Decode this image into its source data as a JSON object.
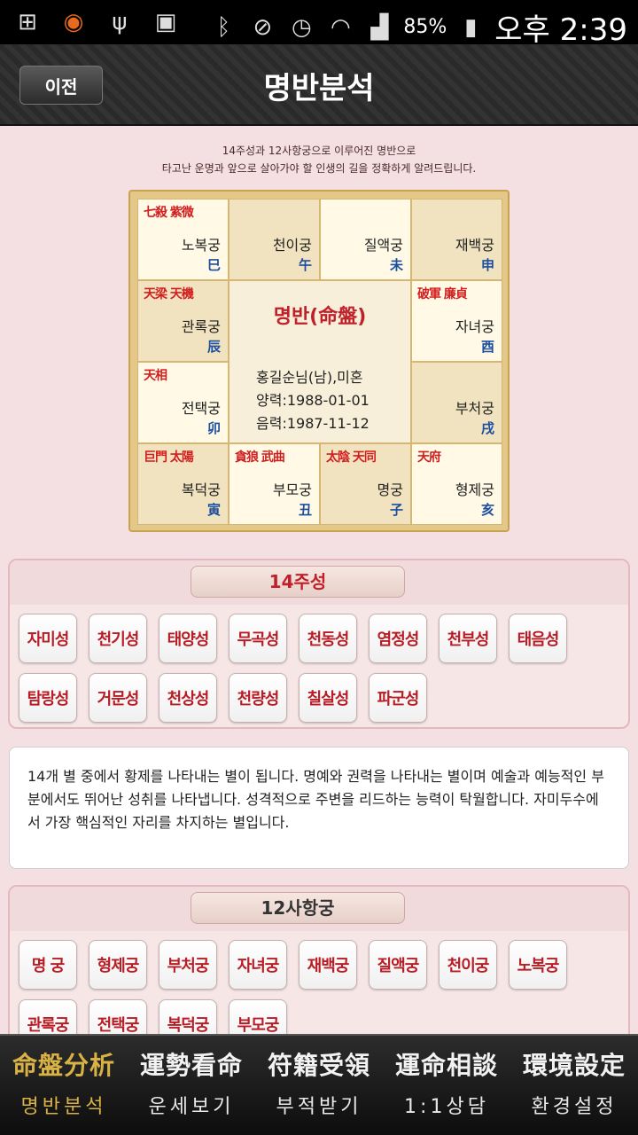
{
  "status_bar": {
    "icons": [
      "plus-icon",
      "headphones-icon",
      "usb-icon",
      "image-icon",
      "bluetooth-icon",
      "mute-icon",
      "alarm-icon",
      "wifi-icon",
      "signal-icon",
      "battery-icon"
    ],
    "battery": "85%",
    "time": "오후 2:39"
  },
  "header": {
    "back_label": "이전",
    "title": "명반분석"
  },
  "intro": {
    "line1": "14주성과 12사항궁으로 이루어진 명반으로",
    "line2": "타고난 운명과 앞으로 살아가야 할 인생의 길을 정확하게 알려드립니다."
  },
  "chart": {
    "cells": [
      {
        "stars": "七殺 紫微",
        "palace": "노복궁",
        "branch": "巳"
      },
      {
        "stars": "",
        "palace": "천이궁",
        "branch": "午"
      },
      {
        "stars": "",
        "palace": "질액궁",
        "branch": "未"
      },
      {
        "stars": "",
        "palace": "재백궁",
        "branch": "申"
      },
      {
        "stars": "天梁 天機",
        "palace": "관록궁",
        "branch": "辰"
      },
      {
        "stars": "破軍 廉貞",
        "palace": "자녀궁",
        "branch": "酉"
      },
      {
        "stars": "天相",
        "palace": "전택궁",
        "branch": "卯"
      },
      {
        "stars": "",
        "palace": "부처궁",
        "branch": "戌"
      },
      {
        "stars": "巨門 太陽",
        "palace": "복덕궁",
        "branch": "寅"
      },
      {
        "stars": "貪狼 武曲",
        "palace": "부모궁",
        "branch": "丑"
      },
      {
        "stars": "太陰 天同",
        "palace": "명궁",
        "branch": "子"
      },
      {
        "stars": "天府",
        "palace": "형제궁",
        "branch": "亥"
      }
    ],
    "center": {
      "title": "명반(命盤)",
      "name": "홍길순님(남),미혼",
      "solar": "양력:1988-01-01",
      "lunar": "음력:1987-11-12"
    }
  },
  "main_stars": {
    "title": "14주성",
    "items": [
      "자미성",
      "천기성",
      "태양성",
      "무곡성",
      "천동성",
      "염정성",
      "천부성",
      "태음성",
      "탐랑성",
      "거문성",
      "천상성",
      "천량성",
      "칠살성",
      "파군성"
    ]
  },
  "description": "14개 별 중에서 황제를 나타내는 별이 됩니다. 명예와 권력을 나타내는 별이며 예술과 예능적인 부분에서도 뛰어난 성취를 나타냅니다. 성격적으로 주변을 리드하는 능력이 탁월합니다. 자미두수에서 가장 핵심적인 자리를 차지하는 별입니다.",
  "palaces": {
    "title": "12사항궁",
    "items": [
      "명 궁",
      "형제궁",
      "부처궁",
      "자녀궁",
      "재백궁",
      "질액궁",
      "천이궁",
      "노복궁",
      "관록궁",
      "전택궁",
      "복덕궁",
      "부모궁"
    ]
  },
  "bottom_nav": [
    {
      "hanja": "命盤分析",
      "label": "명반분석",
      "active": true
    },
    {
      "hanja": "運勢看命",
      "label": "운세보기",
      "active": false
    },
    {
      "hanja": "符籍受領",
      "label": "부적받기",
      "active": false
    },
    {
      "hanja": "運命相談",
      "label": "1:1상담",
      "active": false
    },
    {
      "hanja": "環境設定",
      "label": "환경설정",
      "active": false
    }
  ]
}
